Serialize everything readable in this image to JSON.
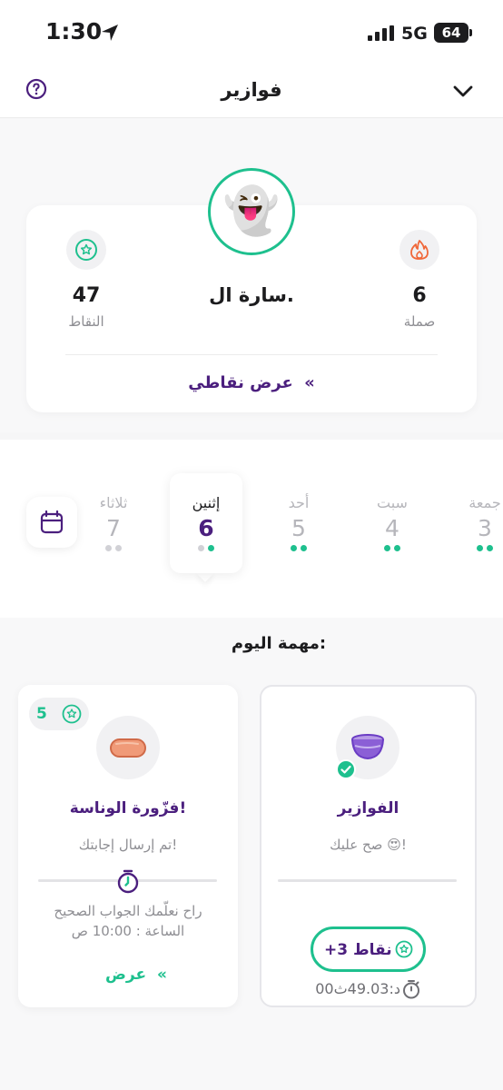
{
  "status_bar": {
    "time": "1:30",
    "network": "5G",
    "battery": "64"
  },
  "nav": {
    "title": "فوازير"
  },
  "profile": {
    "name": "سارة ال.",
    "streak": {
      "value": "6",
      "label": "صملة"
    },
    "points": {
      "value": "47",
      "label": "النقاط"
    },
    "view_points": "عرض نقاطي"
  },
  "week": {
    "days": [
      {
        "name": "جمعة",
        "number": "3"
      },
      {
        "name": "سبت",
        "number": "4"
      },
      {
        "name": "أحد",
        "number": "5"
      },
      {
        "name": "إثنين",
        "number": "6"
      },
      {
        "name": "ثلاثاء",
        "number": "7"
      }
    ]
  },
  "task": {
    "title": "مهمة اليوم:",
    "riddles_card": {
      "heading": "الفوازير",
      "subtitle": "صح عليك 😍!",
      "points": "+3  نقاط",
      "timer": "00د:49.03ث"
    },
    "easter_card": {
      "reward": "5",
      "heading": "فزّورة الوناسة!",
      "subtitle": "تم إرسال إجابتك!",
      "reveal_line1": "راح نعلّمك الجواب الصحيح",
      "reveal_line2": "الساعة : 10:00 ص",
      "view_button": "عرض"
    }
  },
  "colors": {
    "accent": "#1ec08e",
    "brand": "#4b1f7e",
    "flame": "#f0683a"
  }
}
